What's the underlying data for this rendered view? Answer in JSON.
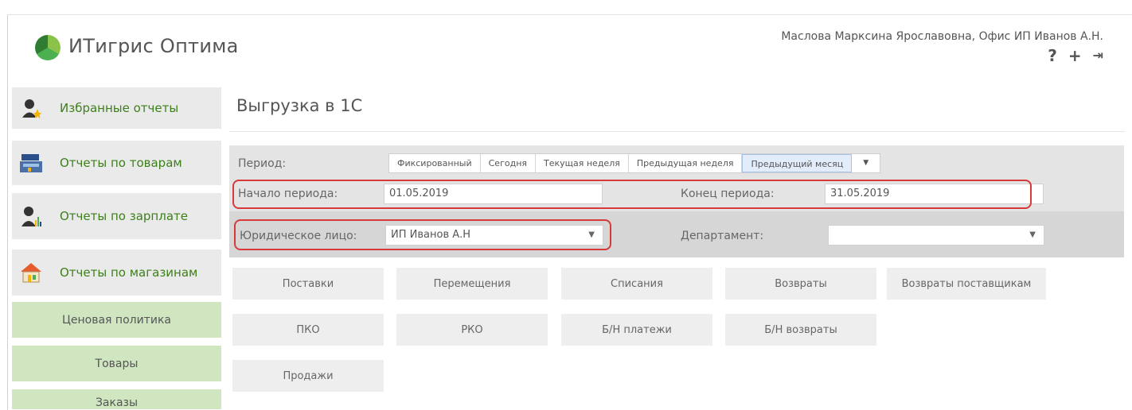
{
  "header": {
    "app_title": "ИТигрис Оптима",
    "user_info": "Маслова Марксина Ярославовна, Офис ИП Иванов А.Н.",
    "help_icon": "?",
    "add_icon": "+",
    "logout_icon": "⇥"
  },
  "sidebar": {
    "items": [
      {
        "label": "Избранные отчеты",
        "icon": "user-star-icon"
      },
      {
        "label": "Отчеты по товарам",
        "icon": "cash-register-icon"
      },
      {
        "label": "Отчеты по зарплате",
        "icon": "user-chart-icon"
      },
      {
        "label": "Отчеты по магазинам",
        "icon": "store-icon"
      }
    ],
    "subitems": [
      {
        "label": "Ценовая политика"
      },
      {
        "label": "Товары"
      },
      {
        "label": "Заказы"
      }
    ]
  },
  "page": {
    "title": "Выгрузка в 1С"
  },
  "filters": {
    "period_label": "Период:",
    "period_buttons": [
      "Фиксированный",
      "Сегодня",
      "Текущая неделя",
      "Предыдущая неделя",
      "Предыдущий месяц"
    ],
    "period_active": "Предыдущий месяц",
    "period_caret": "▼",
    "start_label": "Начало периода:",
    "start_value": "01.05.2019",
    "end_label": "Конец периода:",
    "end_value": "31.05.2019",
    "entity_label": "Юридическое лицо:",
    "entity_value": "ИП Иванов А.Н",
    "department_label": "Департамент:",
    "department_value": "",
    "dropdown_arrow": "▼"
  },
  "actions": {
    "row1": [
      "Поставки",
      "Перемещения",
      "Списания",
      "Возвраты",
      "Возвраты поставщикам"
    ],
    "row2": [
      "ПКО",
      "РКО",
      "Б/Н платежи",
      "Б/Н возвраты"
    ],
    "row3": [
      "Продажи"
    ]
  },
  "colors": {
    "accent_green": "#3d7f1b",
    "submenu_green": "#cfe6c0",
    "highlight_red": "#d63a3a",
    "active_tab": "#e3ecfa"
  }
}
